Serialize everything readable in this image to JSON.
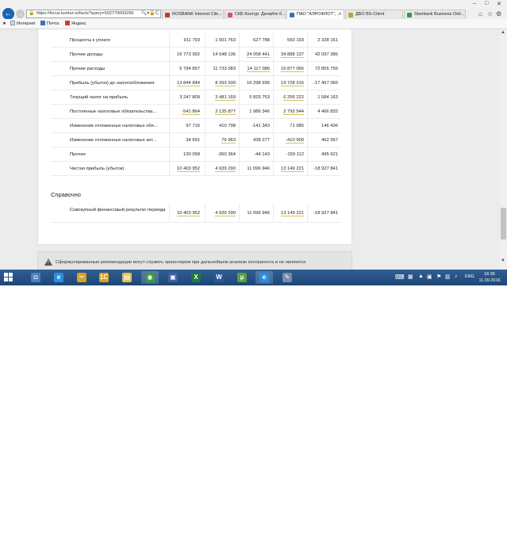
{
  "browser": {
    "url": "https://focus.kontur.ru/facts?query=502770009266",
    "tabs": [
      {
        "label": "ROSBANK Internet Clie...",
        "color": "#c0392b"
      },
      {
        "label": "СКБ Контур: Делайте б...",
        "color": "#d24e8c"
      },
      {
        "label": "ПАО \"АЭРОФЛОТ\", ...",
        "color": "#3d6fb5"
      },
      {
        "label": "ДБО BS-Client",
        "color": "#c0a040"
      },
      {
        "label": "Sberbank Business Onli...",
        "color": "#2e9d3f"
      }
    ],
    "window_controls": [
      "–",
      "□",
      "✕"
    ],
    "tool_icons": [
      "home-icon",
      "star-icon",
      "gear-icon"
    ],
    "favorites": [
      {
        "label": "Интернет",
        "icon": "page-icon"
      },
      {
        "label": "Почта",
        "icon": "mail-icon"
      },
      {
        "label": "Яндекс",
        "icon": "yandex-icon"
      }
    ]
  },
  "table": {
    "rows": [
      {
        "label": "Проценты к уплате",
        "values": [
          "911 793",
          "1 001 763",
          "627 788",
          "550 193",
          "2 328 161"
        ],
        "links": [
          false,
          false,
          false,
          false,
          false
        ]
      },
      {
        "label": "Прочие доходы",
        "values": [
          "16 773 992",
          "14 548 136",
          "24 058 441",
          "34 888 137",
          "42 097 386"
        ],
        "links": [
          false,
          false,
          true,
          true,
          false
        ]
      },
      {
        "label": "Прочие расходы",
        "values": [
          "5 794 897",
          "11 733 083",
          "14 117 086",
          "16 877 066",
          "72 855 755"
        ],
        "links": [
          false,
          false,
          true,
          true,
          false
        ]
      },
      {
        "label": "Прибыль (убыток) до налогообложения",
        "values": [
          "13 844 844",
          "8 393 930",
          "16 298 936",
          "19 728 316",
          "-17 457 060"
        ],
        "links": [
          true,
          true,
          false,
          true,
          false
        ]
      },
      {
        "label": "Текущий налог на прибыль",
        "values": [
          "3 247 809",
          "3 481 169",
          "5 825 753",
          "6 256 222",
          "1 584 163"
        ],
        "links": [
          false,
          true,
          false,
          true,
          false
        ]
      },
      {
        "label": "Постоянные налоговые обязательства...",
        "values": [
          "-541 864",
          "2 135 877",
          "1 986 346",
          "2 792 544",
          "4 466 832"
        ],
        "links": [
          true,
          true,
          false,
          true,
          false
        ]
      },
      {
        "label": "Изменение отложенных налоговых обя...",
        "values": [
          "97 716",
          "410 798",
          "-141 343",
          "71 085",
          "146 436"
        ],
        "links": [
          false,
          false,
          false,
          false,
          false
        ]
      },
      {
        "label": "Изменение отложенных налоговых акт...",
        "values": [
          "34 691",
          "76 963",
          "438 277",
          "-410 900",
          "462 567"
        ],
        "links": [
          false,
          true,
          false,
          true,
          false
        ]
      },
      {
        "label": "Прочее",
        "values": [
          "130 058",
          "-360 364",
          "-44 143",
          "-159 112",
          "495 621"
        ],
        "links": [
          false,
          false,
          false,
          false,
          false
        ]
      },
      {
        "label": "Чистая прибыль (убыток)",
        "values": [
          "10 403 952",
          "4 939 290",
          "11 096 946",
          "13 149 221",
          "-18 927 841"
        ],
        "links": [
          true,
          true,
          false,
          true,
          false
        ]
      }
    ],
    "section_title": "Справочно",
    "reference_row": {
      "label": "Совокупный финансовый результат периода",
      "values": [
        "10 403 952",
        "4 939 290",
        "11 096 946",
        "13 149 221",
        "-18 927 841"
      ],
      "links": [
        true,
        true,
        false,
        true,
        false
      ]
    }
  },
  "notice": {
    "text": "Сформулированные рекомендации могут служить ориентиром при дальнейшем анализе контрагента и не являются"
  },
  "taskbar": {
    "apps": [
      {
        "name": "network-app-icon",
        "glyph": "◘",
        "color": "#4a7fc0"
      },
      {
        "name": "internet-explorer-icon",
        "glyph": "e",
        "color": "#2a8fe0"
      },
      {
        "name": "tools-app-icon",
        "glyph": "✂",
        "color": "#d6a020"
      },
      {
        "name": "1c-app-icon",
        "glyph": "1С",
        "color": "#e0a010"
      },
      {
        "name": "file-explorer-icon",
        "glyph": "▤",
        "color": "#e2c25a"
      },
      {
        "name": "chrome-icon",
        "glyph": "◉",
        "color": "#3a9a45"
      },
      {
        "name": "remote-app-icon",
        "glyph": "▣",
        "color": "#3f5fa8"
      },
      {
        "name": "excel-icon",
        "glyph": "X",
        "color": "#1e7a3a"
      },
      {
        "name": "word-icon",
        "glyph": "W",
        "color": "#2b579a"
      },
      {
        "name": "utorrent-icon",
        "glyph": "µ",
        "color": "#5aa03a"
      },
      {
        "name": "internet-explorer-icon-2",
        "glyph": "e",
        "color": "#2a8fe0"
      },
      {
        "name": "misc-app-icon",
        "glyph": "✎",
        "color": "#7a8aa8"
      }
    ],
    "language": "ENG",
    "time": "16:36",
    "date": "11.09.2016"
  }
}
